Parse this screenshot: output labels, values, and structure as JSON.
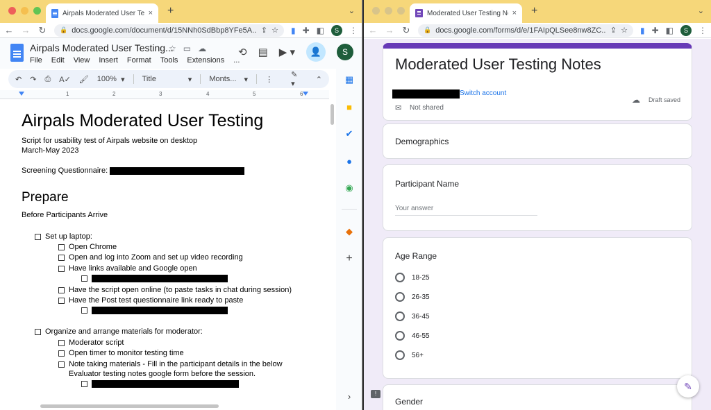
{
  "left": {
    "tab_title": "Airpals Moderated User Testing",
    "tab_close": "×",
    "new_tab": "+",
    "url": "docs.google.com/document/d/15NNh0SdBbp8YFe5A...",
    "avatar": "S",
    "doc_title": "Airpals Moderated User Testing...",
    "menu": [
      "File",
      "Edit",
      "View",
      "Insert",
      "Format",
      "Tools",
      "Extensions",
      "..."
    ],
    "toolbar": {
      "zoom": "100%",
      "style": "Title",
      "font": "Monts..."
    },
    "ruler": [
      "1",
      "2",
      "3",
      "4",
      "5",
      "6"
    ],
    "doc": {
      "heading": "Airpals Moderated User Testing",
      "subtitle_1": "Script for usability test of Airpals website on desktop",
      "subtitle_2": "March-May 2023",
      "screening": "Screening Questionnaire:",
      "prepare": "Prepare",
      "before": "Before Participants Arrive",
      "items": [
        "Set up laptop:",
        "Open Chrome",
        "Open and log into Zoom and set up video recording",
        "Have links available and Google open",
        "Have the script open online (to paste tasks in chat during session)",
        "Have the Post test questionnaire link ready to paste",
        "Organize and arrange materials for moderator:",
        "Moderator script",
        "Open timer to monitor testing time",
        "Note taking materials - Fill in the participant details in the below",
        "Evaluator testing notes google form before the session."
      ]
    }
  },
  "right": {
    "tab_title": "Moderated User Testing Notes",
    "tab_close": "×",
    "new_tab": "+",
    "url": "docs.google.com/forms/d/e/1FAIpQLSee8nw8ZC...",
    "avatar": "S",
    "form_title": "Moderated User Testing Notes",
    "switch_account": "Switch account",
    "not_shared": "Not shared",
    "draft_saved": "Draft saved",
    "sections": {
      "demographics": "Demographics",
      "participant_name": "Participant Name",
      "your_answer": "Your answer",
      "age_range": "Age Range",
      "age_options": [
        "18-25",
        "26-35",
        "36-45",
        "46-55",
        "56+"
      ],
      "gender": "Gender"
    },
    "colors": {
      "accent": "#673ab7",
      "background": "#f0ebf8"
    }
  }
}
